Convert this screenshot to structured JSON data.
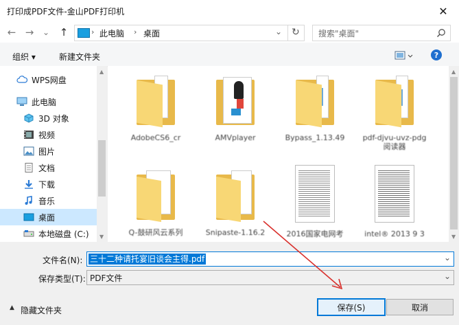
{
  "window": {
    "title": "打印成PDF文件-金山PDF打印机",
    "close_glyph": "✕"
  },
  "nav": {
    "back_glyph": "←",
    "forward_glyph": "→",
    "dropdown_glyph": "⌄",
    "up_glyph": "↑",
    "path": [
      "此电脑",
      "桌面"
    ],
    "path_sep": "›",
    "refresh_glyph": "↻",
    "search_placeholder": "搜索\"桌面\"",
    "search_icon": "search-icon"
  },
  "toolbar": {
    "organize": "组织 ▾",
    "new_folder": "新建文件夹",
    "help": "?"
  },
  "sidebar": {
    "items": [
      {
        "label": "WPS网盘",
        "icon": "cloud-icon"
      },
      {
        "label": "此电脑",
        "icon": "computer-icon"
      },
      {
        "label": "3D 对象",
        "icon": "cube-icon"
      },
      {
        "label": "视频",
        "icon": "video-icon"
      },
      {
        "label": "图片",
        "icon": "picture-icon"
      },
      {
        "label": "文档",
        "icon": "document-icon"
      },
      {
        "label": "下载",
        "icon": "download-icon"
      },
      {
        "label": "音乐",
        "icon": "music-icon"
      },
      {
        "label": "桌面",
        "icon": "desktop-icon",
        "selected": true
      },
      {
        "label": "本地磁盘 (C:)",
        "icon": "disk-icon"
      }
    ]
  },
  "files": [
    {
      "label": "AdobeCS6_cr",
      "kind": "folder"
    },
    {
      "label": "AMVplayer",
      "kind": "folder-app"
    },
    {
      "label": "Bypass_1.13.49",
      "kind": "folder"
    },
    {
      "label": "pdf-djvu-uvz-pdg阅读器",
      "kind": "folder"
    },
    {
      "label": "Q-鼓研风云系列",
      "kind": "folder-doc"
    },
    {
      "label": "Snipaste-1.16.2",
      "kind": "folder"
    },
    {
      "label": "2016国家电网考",
      "kind": "document"
    },
    {
      "label": "intel® 2013 9 3",
      "kind": "document"
    }
  ],
  "form": {
    "filename_label": "文件名(N):",
    "filename_value": "三十二种请托宴旧谈会主得.pdf",
    "filetype_label": "保存类型(T):",
    "filetype_value": "PDF文件",
    "hide_folders": "隐藏文件夹",
    "save": "保存(S)",
    "cancel": "取消",
    "chevron": "⌄"
  },
  "colors": {
    "accent": "#0078d7",
    "selection_bg": "#cce8ff",
    "folder": "#f8d775",
    "folder_dark": "#e8b94a",
    "arrow": "#d9302c"
  }
}
